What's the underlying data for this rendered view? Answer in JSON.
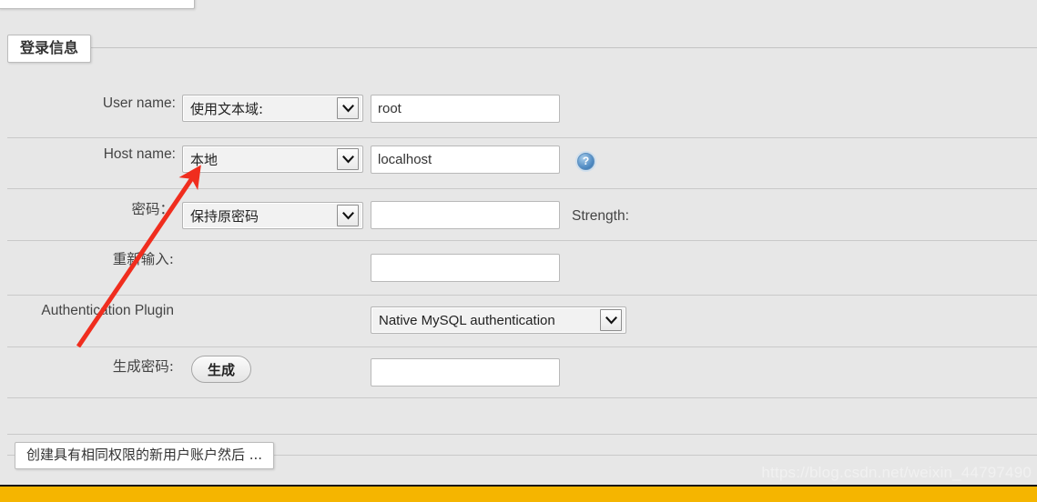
{
  "page": {
    "background_color": "#e7e7e7",
    "footer_bar_color": "#f5b500",
    "accent_red": "#f02d1e"
  },
  "login_section": {
    "legend": "登录信息",
    "rows": [
      {
        "label": "User name:",
        "select_value": "使用文本域:",
        "input_value": "root",
        "input_placeholder": "",
        "has_help_icon": false
      },
      {
        "label": "Host name:",
        "select_value": "本地",
        "input_value": "localhost",
        "input_placeholder": "",
        "has_help_icon": true,
        "help_icon_glyph": "?"
      },
      {
        "label": "密码：",
        "select_value": "保持原密码",
        "input_value": "",
        "input_placeholder": "",
        "trailing_text": "Strength:"
      },
      {
        "label": "重新输入:",
        "input_value": "",
        "input_placeholder": ""
      },
      {
        "label": "Authentication Plugin",
        "select_value": "Native MySQL authentication"
      },
      {
        "label": "生成密码:",
        "button_label": "生成",
        "input_value": "",
        "input_placeholder": ""
      }
    ]
  },
  "bottom_section": {
    "legend": "创建具有相同权限的新用户账户然后 ..."
  },
  "watermark": {
    "text": "https://blog.csdn.net/weixin_44797490"
  }
}
